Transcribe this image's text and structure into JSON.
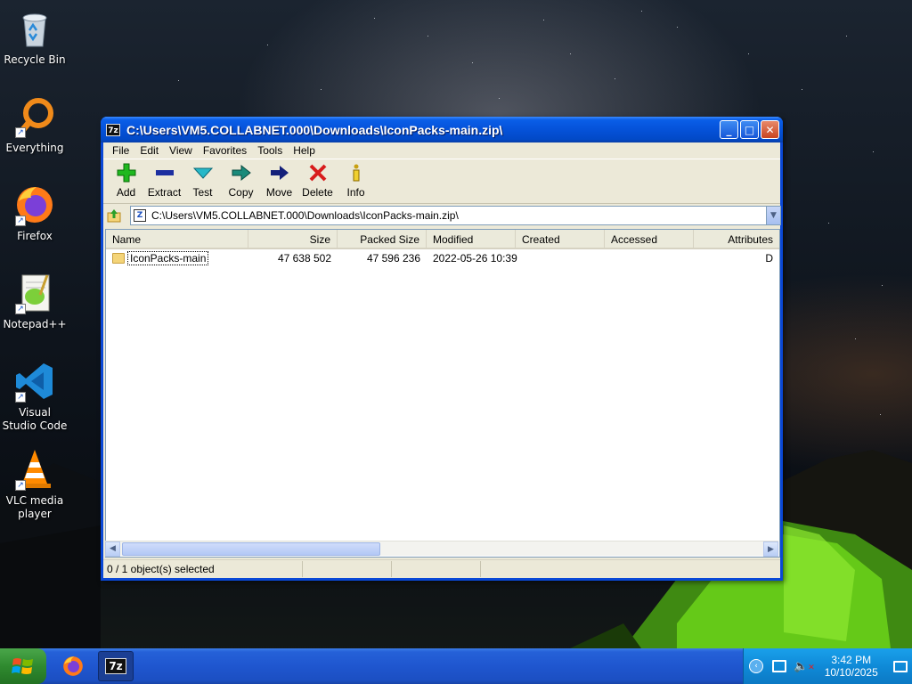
{
  "desktop": {
    "icons": [
      {
        "label": "Recycle Bin",
        "icon": "recycle-bin-icon"
      },
      {
        "label": "Everything",
        "icon": "everything-search-icon"
      },
      {
        "label": "Firefox",
        "icon": "firefox-icon"
      },
      {
        "label": "Notepad++",
        "icon": "notepad-plus-plus-icon"
      },
      {
        "label": "Visual Studio Code",
        "icon": "vscode-icon"
      },
      {
        "label": "VLC media player",
        "icon": "vlc-icon"
      }
    ]
  },
  "window": {
    "app_icon": "7z",
    "title": "C:\\Users\\VM5.COLLABNET.000\\Downloads\\IconPacks-main.zip\\",
    "menu": [
      "File",
      "Edit",
      "View",
      "Favorites",
      "Tools",
      "Help"
    ],
    "toolbar": [
      {
        "label": "Add",
        "icon": "add-icon",
        "color": "#1fb81f"
      },
      {
        "label": "Extract",
        "icon": "extract-icon",
        "color": "#1c2fa0"
      },
      {
        "label": "Test",
        "icon": "test-icon",
        "color": "#1fa0b0"
      },
      {
        "label": "Copy",
        "icon": "copy-icon",
        "color": "#1a8a7a"
      },
      {
        "label": "Move",
        "icon": "move-icon",
        "color": "#14207a"
      },
      {
        "label": "Delete",
        "icon": "delete-icon",
        "color": "#d81c1c"
      },
      {
        "label": "Info",
        "icon": "info-icon",
        "color": "#c8a010"
      }
    ],
    "address": "C:\\Users\\VM5.COLLABNET.000\\Downloads\\IconPacks-main.zip\\",
    "columns": [
      "Name",
      "Size",
      "Packed Size",
      "Modified",
      "Created",
      "Accessed",
      "Attributes"
    ],
    "rows": [
      {
        "name": "IconPacks-main",
        "size": "47 638 502",
        "packed_size": "47 596 236",
        "modified": "2022-05-26 10:39",
        "created": "",
        "accessed": "",
        "attributes": "D"
      }
    ],
    "status": "0 / 1 object(s) selected"
  },
  "taskbar": {
    "apps": [
      {
        "name": "firefox",
        "icon": "firefox-icon"
      },
      {
        "name": "7-zip",
        "icon": "7zip-icon",
        "label": "7z"
      }
    ],
    "clock_time": "3:42 PM",
    "clock_date": "10/10/2025"
  },
  "colors": {
    "titlebar": "#0552d9",
    "taskbar": "#1f56cf",
    "window_bg": "#ece9d8"
  }
}
